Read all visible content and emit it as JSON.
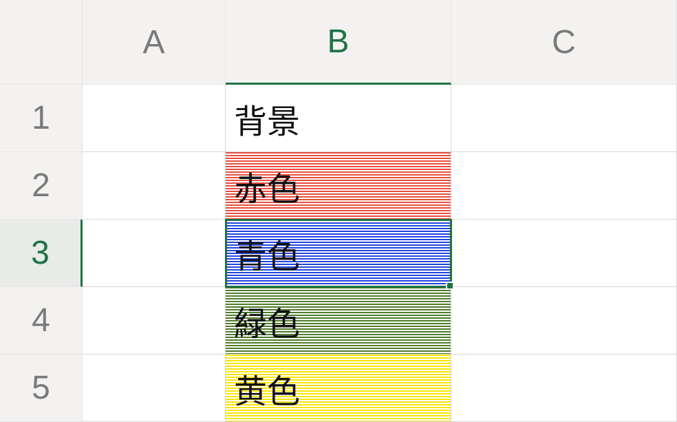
{
  "columns": {
    "header_blank": "",
    "A": "A",
    "B": "B",
    "C": "C"
  },
  "rows": {
    "r1": {
      "num": "1",
      "A": "",
      "B": "背景",
      "C": ""
    },
    "r2": {
      "num": "2",
      "A": "",
      "B": "赤色",
      "C": ""
    },
    "r3": {
      "num": "3",
      "A": "",
      "B": "青色",
      "C": ""
    },
    "r4": {
      "num": "4",
      "A": "",
      "B": "緑色",
      "C": ""
    },
    "r5": {
      "num": "5",
      "A": "",
      "B": "黄色",
      "C": ""
    }
  },
  "selection": {
    "cell": "B3",
    "column": "B",
    "row": "3"
  },
  "colors": {
    "red": "#e74c3c",
    "blue": "#2244dd",
    "green": "#4e7a2a",
    "yellow": "#f8e40a",
    "accent": "#1f7246"
  }
}
